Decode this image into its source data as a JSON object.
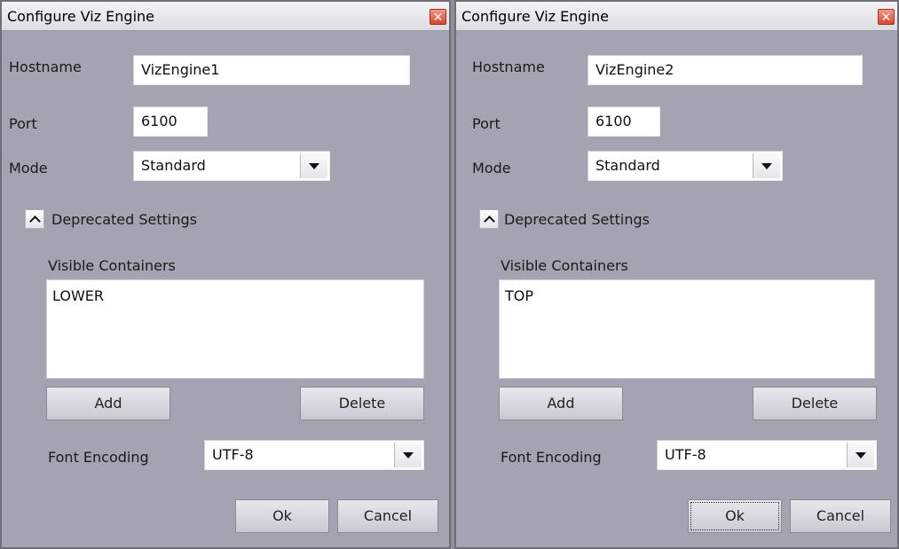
{
  "dialogs": [
    {
      "title": "Configure Viz Engine",
      "close_glyph": "✕",
      "hostname_label": "Hostname",
      "hostname_value": "VizEngine1",
      "port_label": "Port",
      "port_value": "6100",
      "mode_label": "Mode",
      "mode_value": "Standard",
      "deprecated_label": "Deprecated Settings",
      "containers_label": "Visible Containers",
      "containers": [
        "LOWER"
      ],
      "add_label": "Add",
      "delete_label": "Delete",
      "font_encoding_label": "Font Encoding",
      "font_encoding_value": "UTF-8",
      "ok_label": "Ok",
      "cancel_label": "Cancel"
    },
    {
      "title": "Configure Viz Engine",
      "close_glyph": "✕",
      "hostname_label": "Hostname",
      "hostname_value": "VizEngine2",
      "port_label": "Port",
      "port_value": "6100",
      "mode_label": "Mode",
      "mode_value": "Standard",
      "deprecated_label": "Deprecated Settings",
      "containers_label": "Visible Containers",
      "containers": [
        "TOP"
      ],
      "add_label": "Add",
      "delete_label": "Delete",
      "font_encoding_label": "Font Encoding",
      "font_encoding_value": "UTF-8",
      "ok_label": "Ok",
      "cancel_label": "Cancel"
    }
  ]
}
